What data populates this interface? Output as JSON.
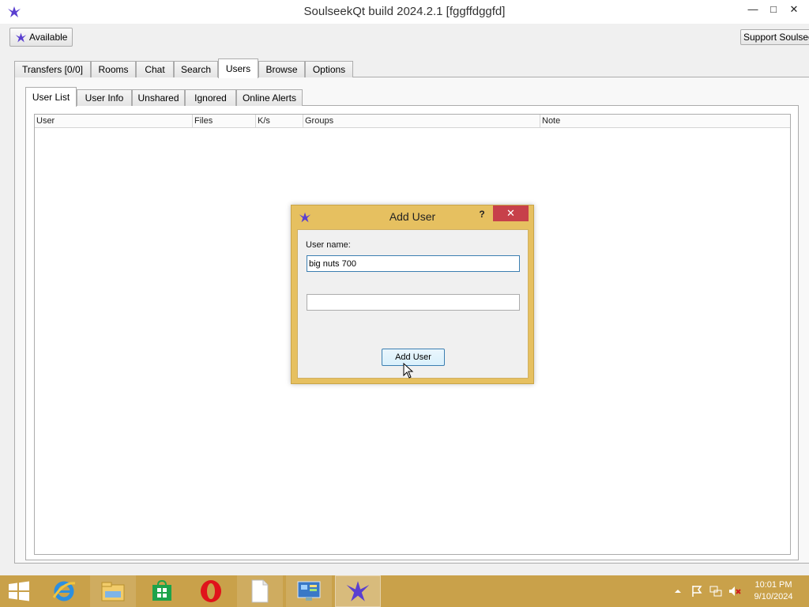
{
  "window": {
    "title": "SoulseekQt build 2024.2.1 [fggffdggfd]",
    "minimize": "—",
    "maximize": "□",
    "close": "✕"
  },
  "toolbar": {
    "status_label": "Available",
    "support_label": "Support Soulseek"
  },
  "main_tabs": [
    "Transfers [0/0]",
    "Rooms",
    "Chat",
    "Search",
    "Users",
    "Browse",
    "Options"
  ],
  "main_tab_active": "Users",
  "sub_tabs": [
    "User List",
    "User Info",
    "Unshared",
    "Ignored",
    "Online Alerts"
  ],
  "sub_tab_active": "User List",
  "user_list": {
    "columns": [
      "User",
      "Files",
      "K/s",
      "Groups",
      "Note"
    ],
    "rows": []
  },
  "dialog": {
    "title": "Add User",
    "help": "?",
    "close": "✕",
    "username_label": "User name:",
    "username_value": "big nuts 700",
    "second_value": "",
    "submit_label": "Add User"
  },
  "taskbar": {
    "items": [
      "start-icon",
      "internet-explorer-icon",
      "file-explorer-icon",
      "store-icon",
      "opera-icon",
      "notepad-icon",
      "control-panel-icon",
      "soulseek-icon"
    ],
    "clock_time": "10:01 PM",
    "clock_date": "9/10/2024"
  },
  "colors": {
    "accent": "#c9a14a",
    "dialog_frame": "#e6c060",
    "close_red": "#c7404a",
    "brand_purple": "#5a3fd0"
  }
}
